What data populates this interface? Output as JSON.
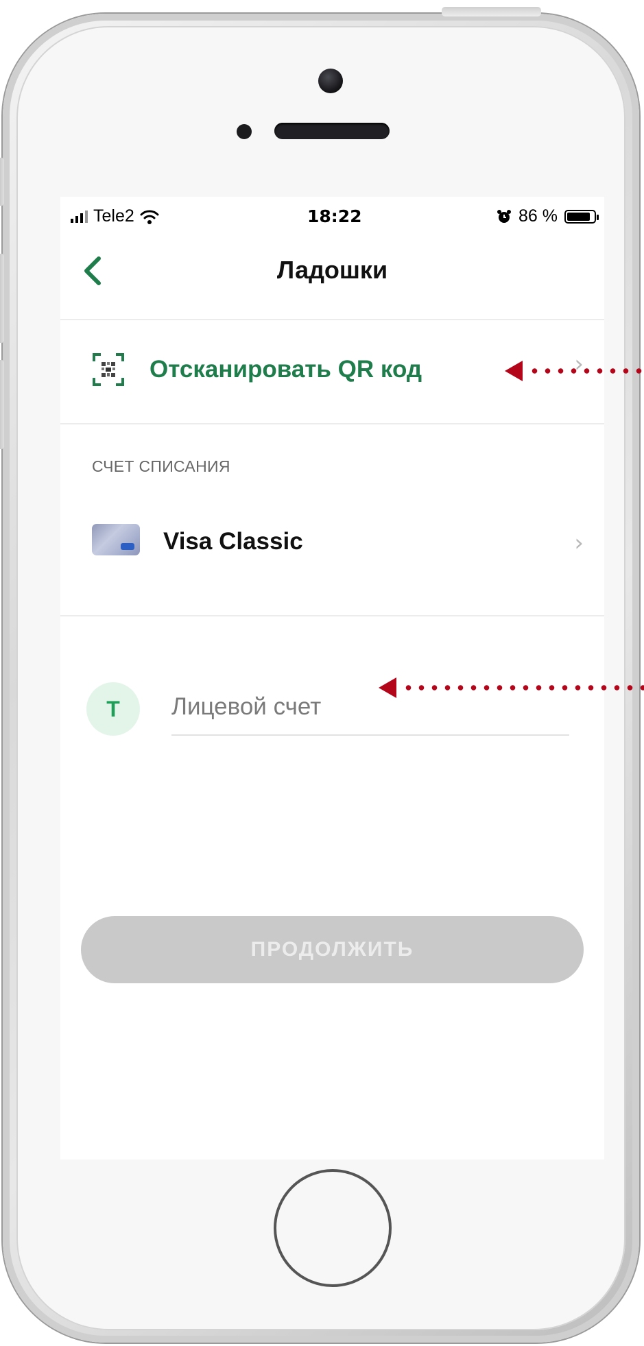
{
  "status_bar": {
    "carrier": "Tele2",
    "time": "18:22",
    "battery": "86 %",
    "battery_level": 0.86
  },
  "nav": {
    "title": "Ладошки",
    "back_icon": "chevron-left-icon"
  },
  "scan": {
    "label": "Отсканировать QR код",
    "icon": "qr-code-icon",
    "chevron": "›"
  },
  "debit_section": {
    "label": "СЧЕТ СПИСАНИЯ",
    "account_name": "Visa Classic",
    "chevron": "›"
  },
  "account_field": {
    "avatar_letter": "Т",
    "value": "",
    "placeholder": "Лицевой счет"
  },
  "continue_button": {
    "label": "ПРОДОЛЖИТЬ",
    "enabled": false
  },
  "colors": {
    "accent": "#1e7d4b",
    "annotation": "#b3061b",
    "button_disabled": "#c9c9c9"
  }
}
